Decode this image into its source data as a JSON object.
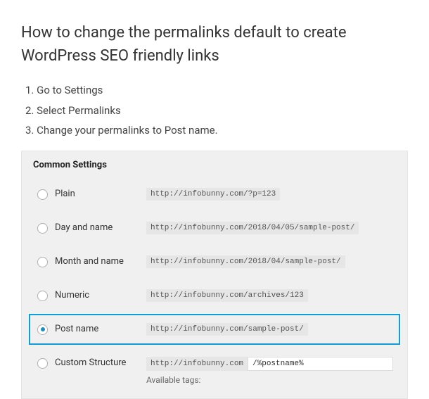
{
  "heading": "How to change the permalinks default to create WordPress SEO friendly links",
  "steps": [
    "1. Go to Settings",
    "2. Select Permalinks",
    "3. Change your permalinks to Post name."
  ],
  "panel": {
    "header": "Common Settings",
    "options": [
      {
        "label": "Plain",
        "url": "http://infobunny.com/?p=123",
        "checked": false,
        "highlighted": false
      },
      {
        "label": "Day and name",
        "url": "http://infobunny.com/2018/04/05/sample-post/",
        "checked": false,
        "highlighted": false
      },
      {
        "label": "Month and name",
        "url": "http://infobunny.com/2018/04/sample-post/",
        "checked": false,
        "highlighted": false
      },
      {
        "label": "Numeric",
        "url": "http://infobunny.com/archives/123",
        "checked": false,
        "highlighted": false
      },
      {
        "label": "Post name",
        "url": "http://infobunny.com/sample-post/",
        "checked": true,
        "highlighted": true
      }
    ],
    "custom": {
      "label": "Custom Structure",
      "base": "http://infobunny.com",
      "value": "/%postname%",
      "available_tags": "Available tags:"
    }
  }
}
